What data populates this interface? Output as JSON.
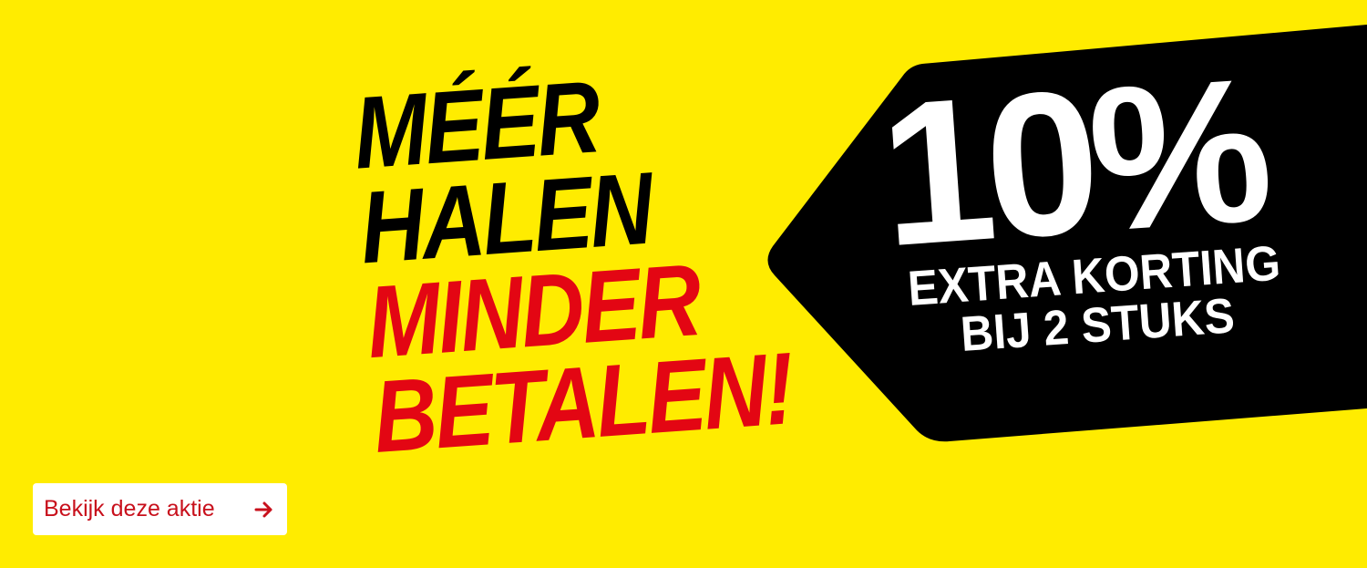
{
  "banner": {
    "headline": {
      "line1": "MÉÉR",
      "line2": "HALEN",
      "line3": "MINDER",
      "line4": "BETALEN!"
    },
    "tag": {
      "percent": "10%",
      "line1": "EXTRA KORTING",
      "line2": "BIJ 2 STUKS"
    },
    "cta": {
      "label": "Bekijk deze aktie"
    }
  },
  "colors": {
    "background": "#FFEC00",
    "tag": "#000000",
    "accent_red": "#E30613",
    "cta_text": "#C8101C",
    "cta_background": "#FFFFFF"
  },
  "icons": {
    "cta_arrow": "arrow-right-icon"
  }
}
